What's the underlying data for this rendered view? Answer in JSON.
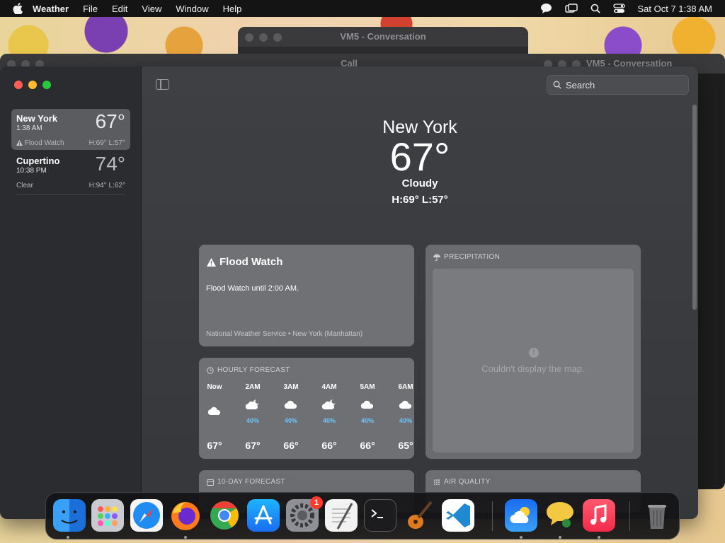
{
  "menubar": {
    "app_name": "Weather",
    "menus": [
      "File",
      "Edit",
      "View",
      "Window",
      "Help"
    ],
    "datetime": "Sat Oct 7  1:38 AM"
  },
  "background_windows": {
    "top_title": "VM5 - Conversation",
    "mid_title": "Call",
    "right_title": "VM5 - Conversation"
  },
  "sidebar": {
    "cities": [
      {
        "name": "New York",
        "time": "1:38 AM",
        "temp": "67°",
        "condition": "Flood Watch",
        "hl": "H:69°  L:57°"
      },
      {
        "name": "Cupertino",
        "time": "10:38 PM",
        "temp": "74°",
        "condition": "Clear",
        "hl": "H:94°  L:62°"
      }
    ]
  },
  "search": {
    "placeholder": "Search"
  },
  "hero": {
    "city": "New York",
    "temp": "67°",
    "condition": "Cloudy",
    "hl": "H:69°  L:57°"
  },
  "flood": {
    "title": "Flood Watch",
    "body": "Flood Watch until 2:00 AM.",
    "source": "National Weather Service • New York (Manhattan)"
  },
  "precipitation": {
    "header": "PRECIPITATION",
    "message": "Couldn't display the map."
  },
  "hourly": {
    "header": "HOURLY FORECAST",
    "hours": [
      {
        "time": "Now",
        "icon": "cloud-icon",
        "precip": "",
        "temp": "67°"
      },
      {
        "time": "2AM",
        "icon": "partly-cloudy-night-icon",
        "precip": "40%",
        "temp": "67°"
      },
      {
        "time": "3AM",
        "icon": "cloud-rain-icon",
        "precip": "40%",
        "temp": "66°"
      },
      {
        "time": "4AM",
        "icon": "partly-cloudy-night-icon",
        "precip": "40%",
        "temp": "66°"
      },
      {
        "time": "5AM",
        "icon": "cloud-rain-icon",
        "precip": "40%",
        "temp": "66°"
      },
      {
        "time": "6AM",
        "icon": "cloud-rain-icon",
        "precip": "40%",
        "temp": "65°"
      }
    ]
  },
  "ten_day": {
    "header": "10-DAY FORECAST"
  },
  "air_quality": {
    "header": "AIR QUALITY"
  },
  "dock": {
    "apps": [
      "Finder",
      "Launchpad",
      "Safari",
      "Firefox",
      "Chrome",
      "App Store",
      "System Settings",
      "TextEdit",
      "Terminal",
      "GarageBand",
      "VS Code",
      "Weather",
      "Messages",
      "Music",
      "Trash"
    ],
    "settings_badge": "1"
  },
  "colors": {
    "accent_blue": "#6cc6ff",
    "close": "#ff5f57",
    "minimize": "#febc2e",
    "maximize": "#28c840"
  }
}
